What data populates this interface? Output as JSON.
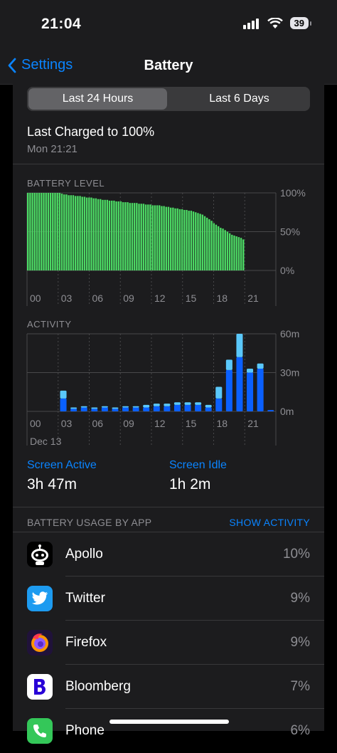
{
  "status": {
    "time": "21:04",
    "battery": "39"
  },
  "nav": {
    "back": "Settings",
    "title": "Battery"
  },
  "tabs": [
    "Last 24 Hours",
    "Last 6 Days"
  ],
  "last_charged": {
    "title": "Last Charged to 100%",
    "time": "Mon 21:21"
  },
  "colors": {
    "accent": "#0a84ff",
    "level_bar": "#4cd964",
    "activity_dark": "#0a60ff",
    "activity_light": "#5ac8fa"
  },
  "chart_data": [
    {
      "type": "bar",
      "title": "BATTERY LEVEL",
      "y_ticks": [
        "100%",
        "50%",
        "0%"
      ],
      "x_ticks": [
        "00",
        "03",
        "06",
        "09",
        "12",
        "15",
        "18",
        "21"
      ],
      "ylim": [
        0,
        100
      ],
      "values": [
        100,
        100,
        100,
        100,
        100,
        100,
        100,
        100,
        100,
        100,
        100,
        100,
        100,
        100,
        100,
        99,
        98,
        98,
        97,
        97,
        97,
        96,
        96,
        96,
        95,
        95,
        94,
        94,
        94,
        93,
        93,
        92,
        92,
        91,
        91,
        91,
        90,
        90,
        90,
        89,
        89,
        89,
        88,
        88,
        88,
        87,
        87,
        87,
        87,
        86,
        86,
        86,
        85,
        85,
        85,
        84,
        84,
        84,
        84,
        83,
        83,
        82,
        82,
        81,
        81,
        80,
        80,
        79,
        79,
        78,
        78,
        77,
        77,
        76,
        75,
        74,
        73,
        72,
        70,
        68,
        66,
        64,
        61,
        59,
        57,
        55,
        54,
        52,
        50,
        48,
        46,
        45,
        44,
        43,
        42,
        40
      ]
    },
    {
      "type": "bar",
      "title": "ACTIVITY",
      "y_ticks": [
        "60m",
        "30m",
        "0m"
      ],
      "x_ticks": [
        "00",
        "03",
        "06",
        "09",
        "12",
        "15",
        "18",
        "21"
      ],
      "date_label": "Dec 13",
      "ylim": [
        0,
        60
      ],
      "series": [
        {
          "name": "Screen Active",
          "values": [
            0,
            0,
            0,
            10,
            2,
            3,
            2,
            3,
            2,
            3,
            3,
            3,
            4,
            4,
            5,
            5,
            5,
            3,
            10,
            32,
            42,
            30,
            33,
            1
          ]
        },
        {
          "name": "Screen Idle",
          "values": [
            0,
            0,
            0,
            6,
            1,
            1,
            1,
            1,
            1,
            1,
            1,
            2,
            2,
            2,
            2,
            2,
            2,
            2,
            9,
            8,
            18,
            3,
            4,
            0
          ]
        }
      ]
    }
  ],
  "screen": {
    "active_label": "Screen Active",
    "active_value": "3h 47m",
    "idle_label": "Screen Idle",
    "idle_value": "1h 2m"
  },
  "usage": {
    "header": "BATTERY USAGE BY APP",
    "show_activity": "SHOW ACTIVITY",
    "apps": [
      {
        "name": "Apollo",
        "pct": "10%",
        "icon": "apollo-icon"
      },
      {
        "name": "Twitter",
        "pct": "9%",
        "icon": "twitter-icon"
      },
      {
        "name": "Firefox",
        "pct": "9%",
        "icon": "firefox-icon"
      },
      {
        "name": "Bloomberg",
        "pct": "7%",
        "icon": "bloomberg-icon"
      },
      {
        "name": "Phone",
        "pct": "6%",
        "icon": "phone-icon"
      }
    ]
  }
}
